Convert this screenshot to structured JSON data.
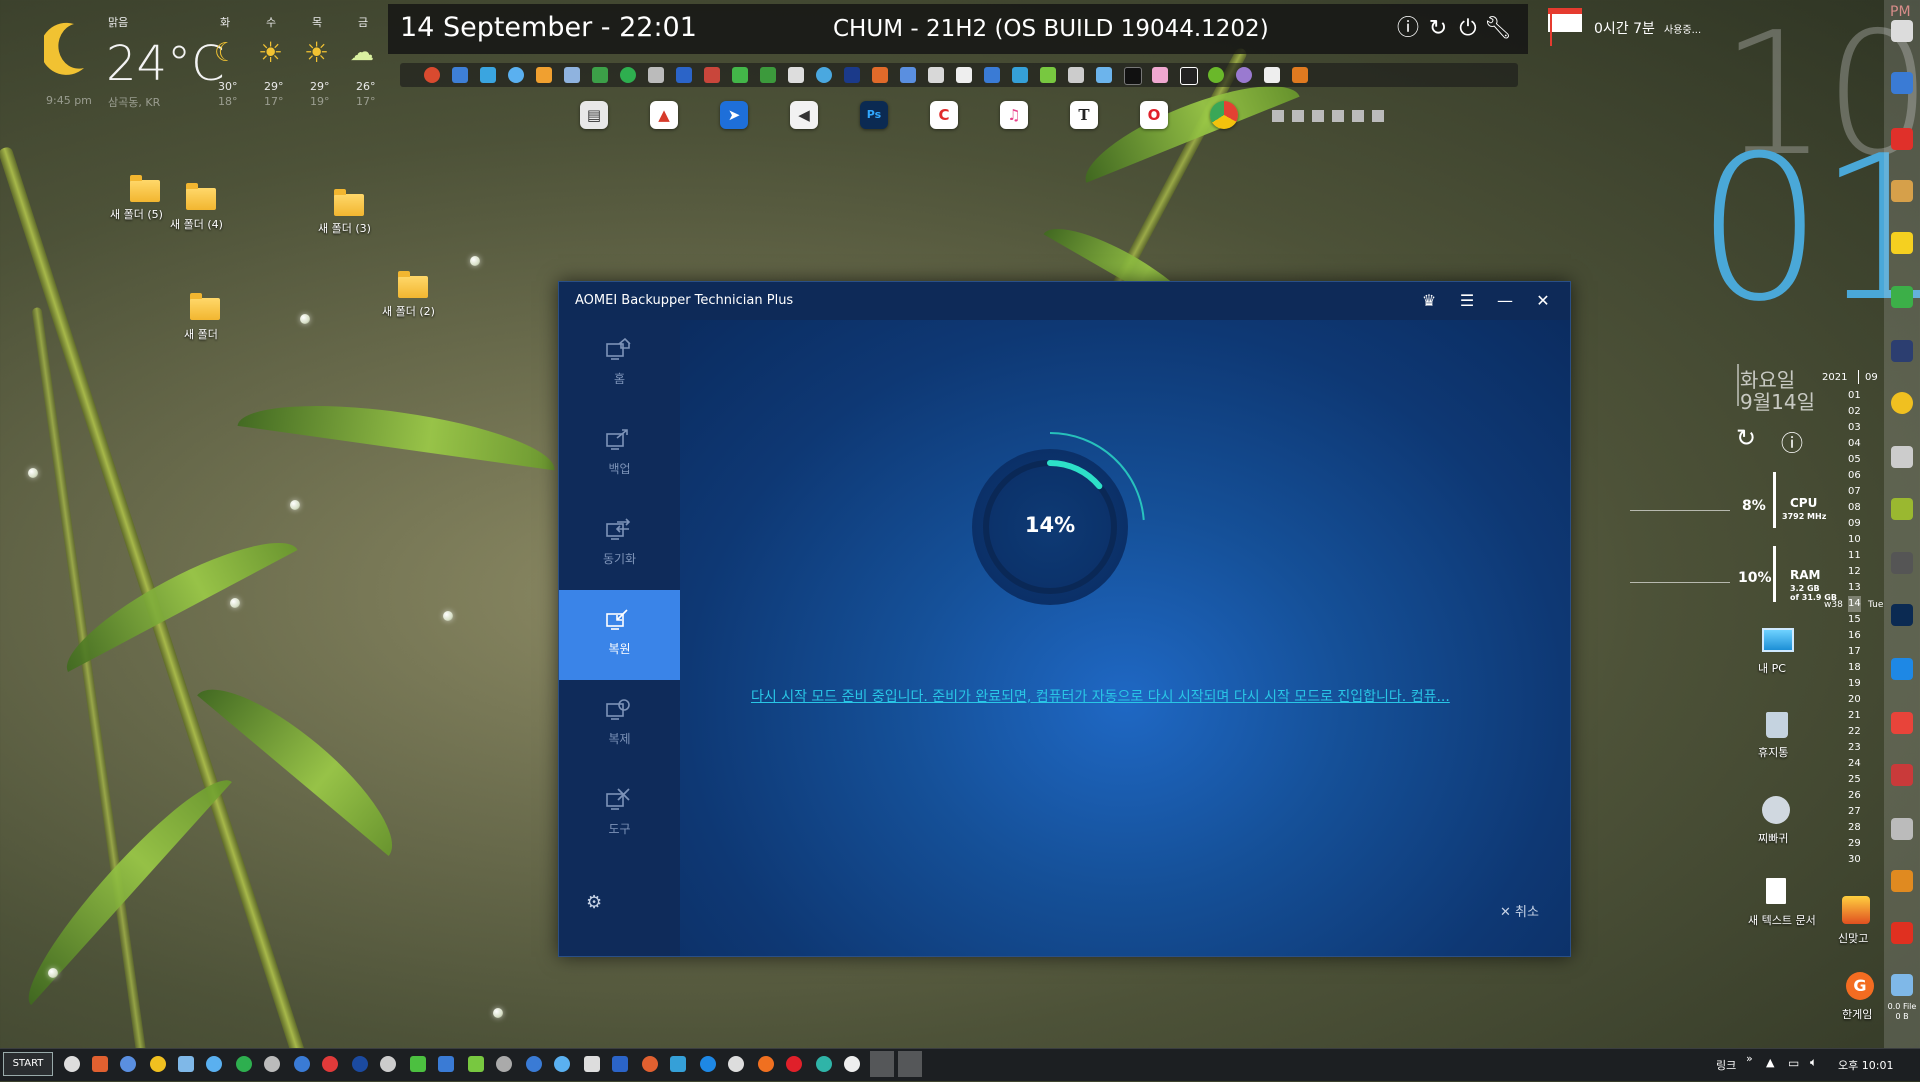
{
  "weather": {
    "condition": "맑음",
    "temperature": "24°C",
    "time": "9:45 pm",
    "location": "삼곡동, KR",
    "forecast": [
      {
        "day": "화",
        "high": "30°",
        "low": "18°"
      },
      {
        "day": "수",
        "high": "29°",
        "low": "17°"
      },
      {
        "day": "목",
        "high": "29°",
        "low": "19°"
      },
      {
        "day": "금",
        "high": "26°",
        "low": "17°"
      }
    ]
  },
  "topbar": {
    "date": "14 September - 22:01",
    "build": "CHUM - 21H2 (OS BUILD 19044.1202)"
  },
  "timer": {
    "label": "0시간 7분",
    "suffix": "사용중..."
  },
  "clock": {
    "ampm": "PM",
    "hour": "10",
    "minute": "01",
    "weekday": "화요일",
    "date": "9월14일"
  },
  "calendar": {
    "year": "2021",
    "month": "09",
    "today_label": "14",
    "today_suffix": "Tue",
    "week": "w38",
    "days": [
      "01",
      "02",
      "03",
      "04",
      "05",
      "06",
      "07",
      "08",
      "09",
      "10",
      "11",
      "12",
      "13",
      "14",
      "15",
      "16",
      "17",
      "18",
      "19",
      "20",
      "21",
      "22",
      "23",
      "24",
      "25",
      "26",
      "27",
      "28",
      "29",
      "30"
    ]
  },
  "system": {
    "cpu": {
      "percent": "8%",
      "label": "CPU",
      "detail": "3792 MHz"
    },
    "ram": {
      "percent": "10%",
      "label": "RAM",
      "detail1": "3.2 GB",
      "detail2": "of 31.9 GB"
    }
  },
  "desktop": {
    "folders": [
      "새 폴더 (5)",
      "새 폴더 (4)",
      "새 폴더 (3)",
      "새 폴더 (2)",
      "새 폴더"
    ],
    "icons": [
      "내 PC",
      "휴지통",
      "찌빠귀",
      "새 텍스트 문서",
      "신맞고",
      "한게임",
      "0.0 File 0 B"
    ]
  },
  "window": {
    "title": "AOMEI Backupper Technician Plus",
    "nav": [
      {
        "label": "홈"
      },
      {
        "label": "백업"
      },
      {
        "label": "동기화"
      },
      {
        "label": "복원"
      },
      {
        "label": "복제"
      },
      {
        "label": "도구"
      }
    ],
    "active_nav": "복원",
    "progress": {
      "value": 14,
      "text": "14%"
    },
    "status_message": "다시 시작 모드 준비 중입니다. 준비가 완료되면, 컴퓨터가 자동으로 다시 시작되며 다시 시작 모드로 진입합니다. 컴퓨...",
    "cancel_label": "취소"
  },
  "taskbar": {
    "start_label": "START",
    "links_label": "링크",
    "clock": "오후 10:01"
  },
  "colors": {
    "accent": "#3a84e8",
    "progress": "#2de0c8",
    "link": "#29c6e6",
    "clock_blue": "#4aa8d8"
  }
}
